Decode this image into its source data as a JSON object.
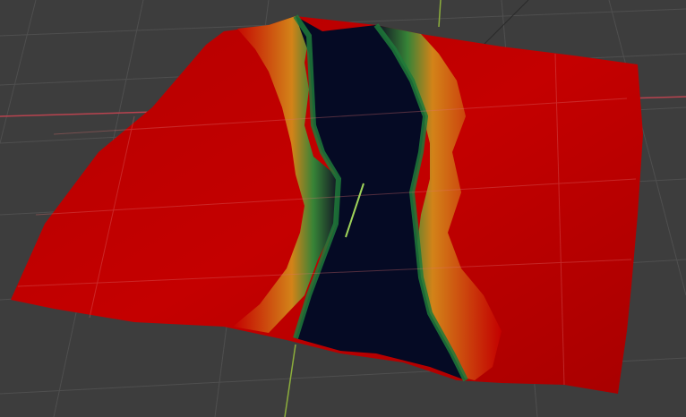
{
  "viewport": {
    "background_color": "#3d3d3d",
    "grid_line_color": "#4f4f4f",
    "x_axis_color": "#b8434f",
    "y_axis_color": "#8cae3c"
  },
  "terrain_mesh": {
    "colors": {
      "high": "#c40000",
      "high_shaded": "#a80000",
      "transition_orange": "#d48a1a",
      "transition_yellow": "#c8b02a",
      "transition_green": "#2f8a3a",
      "teal": "#0f5a4a",
      "valley": "#050a24"
    }
  }
}
